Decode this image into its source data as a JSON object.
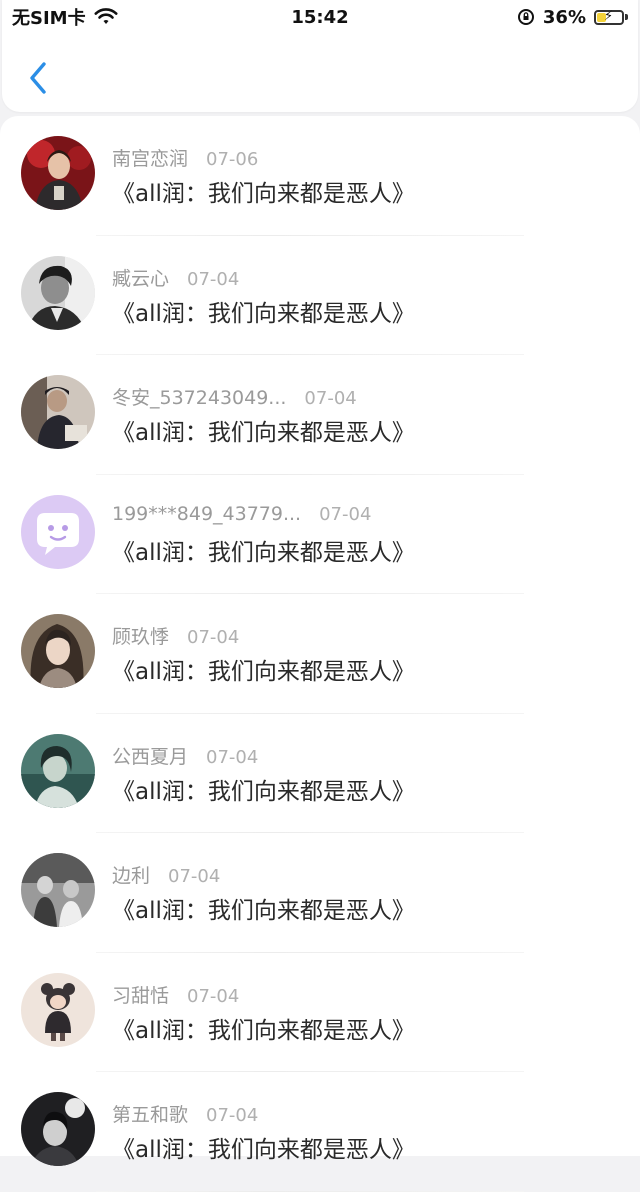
{
  "status_bar": {
    "carrier": "无SIM卡",
    "time": "15:42",
    "battery_percent": "36%",
    "battery_level": 0.36
  },
  "nav": {
    "back_icon": "chevron-left-icon",
    "accent": "#2b8ee6"
  },
  "list": {
    "items": [
      {
        "name": "南宫恋润",
        "date": "07-06",
        "title": "《all润：我们向来都是恶人》",
        "avatar": "photo-red-stage"
      },
      {
        "name": "臧云心",
        "date": "07-04",
        "title": "《all润：我们向来都是恶人》",
        "avatar": "photo-bw-portrait"
      },
      {
        "name": "冬安_537243049...",
        "date": "07-04",
        "title": "《all润：我们向来都是恶人》",
        "avatar": "photo-dark-room"
      },
      {
        "name": "199***849_43779...",
        "date": "07-04",
        "title": "《all润：我们向来都是恶人》",
        "avatar": "chat-bubble-icon"
      },
      {
        "name": "顾玖悸",
        "date": "07-04",
        "title": "《all润：我们向来都是恶人》",
        "avatar": "photo-girl-portrait"
      },
      {
        "name": "公西夏月",
        "date": "07-04",
        "title": "《all润：我们向来都是恶人》",
        "avatar": "photo-teal-portrait"
      },
      {
        "name": "边利",
        "date": "07-04",
        "title": "《all润：我们向来都是恶人》",
        "avatar": "photo-gray-group"
      },
      {
        "name": "习甜恬",
        "date": "07-04",
        "title": "《all润：我们向来都是恶人》",
        "avatar": "photo-child-doll"
      },
      {
        "name": "第五和歌",
        "date": "07-04",
        "title": "《all润：我们向来都是恶人》",
        "avatar": "photo-dark-figure"
      }
    ]
  }
}
